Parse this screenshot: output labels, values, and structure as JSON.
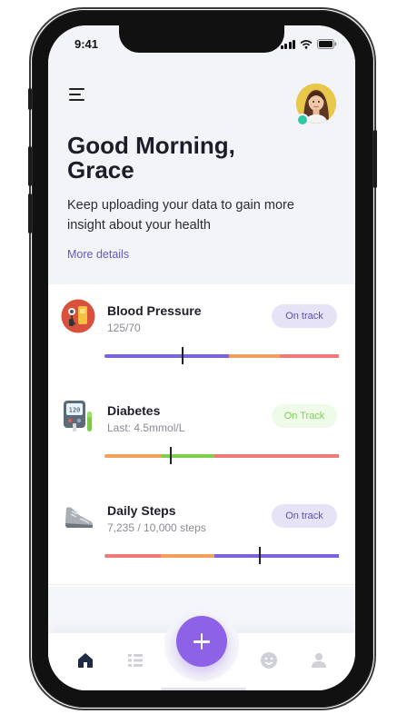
{
  "status_bar": {
    "time": "9:41"
  },
  "header": {
    "greeting_line1": "Good Morning,",
    "greeting_line2": "Grace",
    "subtext": "Keep uploading your data to gain more insight about your health",
    "more_details": "More details"
  },
  "cards": [
    {
      "title": "Blood Pressure",
      "subtitle": "125/70",
      "status": "On track",
      "status_style": "purple",
      "icon": "blood-pressure-monitor-icon",
      "segments": [
        {
          "color": "#7b63dc",
          "fraction": 0.53
        },
        {
          "color": "#f2a05d",
          "fraction": 0.22
        },
        {
          "color": "#ef7b78",
          "fraction": 0.25
        }
      ],
      "marker_position": 0.33
    },
    {
      "title": "Diabetes",
      "subtitle": "Last: 4.5mmol/L",
      "status": "On Track",
      "status_style": "green",
      "icon": "glucose-meter-icon",
      "segments": [
        {
          "color": "#f2a05d",
          "fraction": 0.24
        },
        {
          "color": "#7ed04b",
          "fraction": 0.23
        },
        {
          "color": "#ef7b78",
          "fraction": 0.53
        }
      ],
      "marker_position": 0.28
    },
    {
      "title": "Daily Steps",
      "subtitle": "7,235 / 10,000 steps",
      "status": "On track",
      "status_style": "purple",
      "icon": "sneaker-icon",
      "segments": [
        {
          "color": "#ef7b78",
          "fraction": 0.24
        },
        {
          "color": "#f2a05d",
          "fraction": 0.23
        },
        {
          "color": "#7b63dc",
          "fraction": 0.53
        }
      ],
      "marker_position": 0.66
    }
  ],
  "bottom_nav": {
    "items": [
      "home-icon",
      "list-icon",
      "smiley-icon",
      "profile-icon"
    ],
    "fab": "add-icon",
    "active_color": "#1f2a44",
    "inactive_color": "#cfd0d8"
  }
}
